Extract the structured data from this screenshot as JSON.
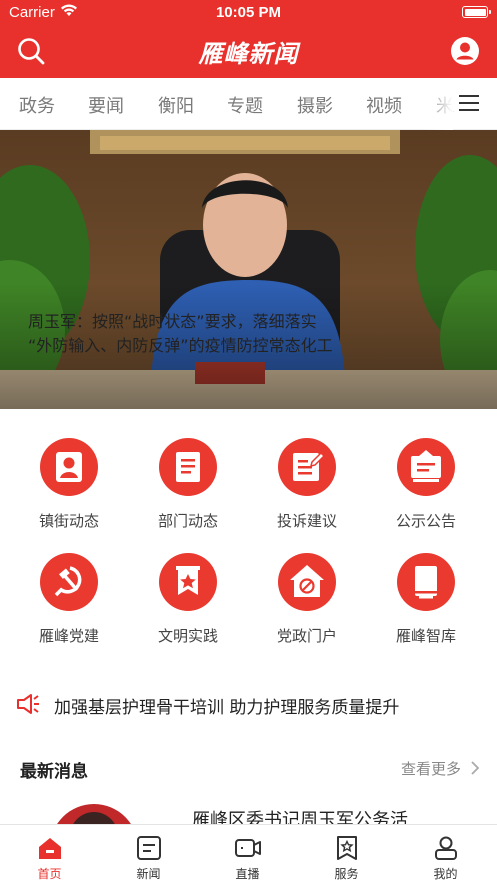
{
  "status_bar": {
    "carrier": "Carrier",
    "time": "10:05 PM"
  },
  "header": {
    "brand": "雁峰新闻",
    "accent_color": "#e8312c",
    "search_icon": "search-icon",
    "user_icon": "user-icon"
  },
  "tabs": [
    "政务",
    "要闻",
    "衡阳",
    "专题",
    "摄影",
    "视频",
    "米"
  ],
  "banner": {
    "caption_line1": "周玉军：按照“战时状态”要求，落细落实",
    "caption_line2": "“外防输入、内防反弹”的疫情防控常态化工",
    "slide_count": 6,
    "active_slide": 1
  },
  "categories": [
    {
      "label": "镇街动态",
      "icon": "person-badge-icon"
    },
    {
      "label": "部门动态",
      "icon": "document-icon"
    },
    {
      "label": "投诉建议",
      "icon": "edit-note-icon"
    },
    {
      "label": "公示公告",
      "icon": "notice-board-icon"
    },
    {
      "label": "雁峰党建",
      "icon": "hammer-sickle-icon"
    },
    {
      "label": "文明实践",
      "icon": "star-banner-icon"
    },
    {
      "label": "党政门户",
      "icon": "house-emblem-icon"
    },
    {
      "label": "雁峰智库",
      "icon": "book-icon"
    }
  ],
  "ticker": {
    "text": "加强基层护理骨干培训 助力护理服务质量提升",
    "icon": "megaphone-icon"
  },
  "latest": {
    "title": "最新消息",
    "more": "查看更多",
    "items": [
      {
        "headline": "雁峰区委书记周玉军公务活"
      }
    ]
  },
  "tabbar": [
    {
      "label": "首页",
      "icon": "home-icon",
      "active": true
    },
    {
      "label": "新闻",
      "icon": "news-icon",
      "active": false
    },
    {
      "label": "直播",
      "icon": "live-camera-icon",
      "active": false
    },
    {
      "label": "服务",
      "icon": "service-icon",
      "active": false
    },
    {
      "label": "我的",
      "icon": "profile-icon",
      "active": false
    }
  ]
}
